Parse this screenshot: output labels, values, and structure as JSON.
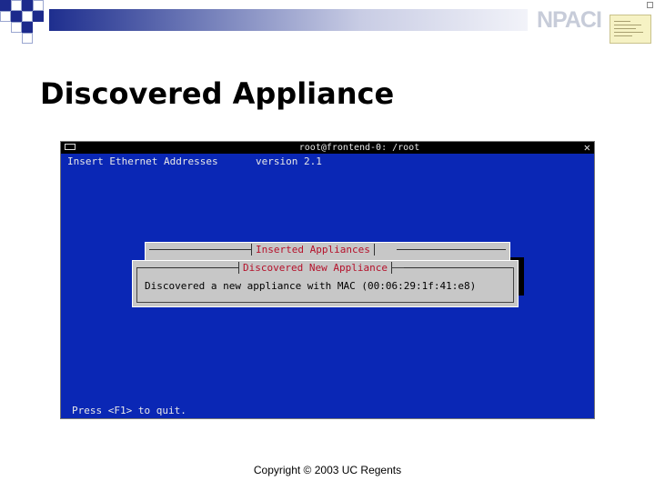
{
  "slide": {
    "logo_text": "NPACI",
    "title": "Discovered Appliance",
    "footer": "Copyright © 2003 UC Regents"
  },
  "terminal": {
    "window_title": "root@frontend-0: /root",
    "close_glyph": "✕",
    "header_left": "Insert Ethernet Addresses",
    "header_right": "version 2.1",
    "back_dialog_title": "Inserted Appliances",
    "front_dialog_title": "Discovered New Appliance",
    "message": "Discovered a new appliance with MAC (00:06:29:1f:41:e8)",
    "status_hint": "Press <F1> to quit."
  },
  "colors": {
    "terminal_bg": "#0a27b5",
    "dialog_bg": "#c7c7c7",
    "dialog_title": "#b5102a",
    "banner_dark": "#1e2e8e"
  }
}
